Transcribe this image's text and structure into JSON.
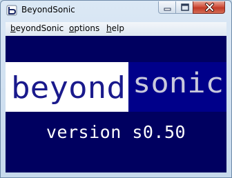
{
  "window": {
    "title": "BeyondSonic",
    "controls": {
      "minimize": "minimize",
      "maximize": "maximize",
      "close": "close"
    }
  },
  "menu": {
    "items": [
      {
        "label": "beyondSonic"
      },
      {
        "label": "options"
      },
      {
        "label": "help"
      }
    ]
  },
  "splash": {
    "logo_left": "beyond",
    "logo_right": "sonic",
    "version": "version s0.50"
  },
  "colors": {
    "client_bg": "#000060",
    "logo_left_bg": "#ffffff",
    "logo_left_text": "#1a1a8c",
    "logo_right_bg": "#00008a",
    "logo_right_text": "#c8c8dc",
    "version_text": "#ffffff"
  }
}
